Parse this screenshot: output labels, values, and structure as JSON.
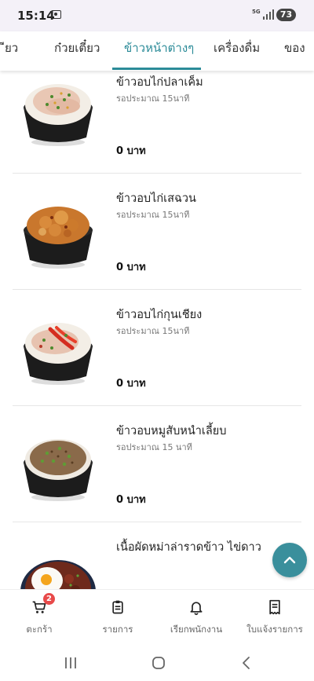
{
  "status_bar": {
    "time": "15:14",
    "network": "5G",
    "battery": "73"
  },
  "tabs": [
    {
      "label": "ข้าวยำ/เส้นก๋วยเตี๋ยว"
    },
    {
      "label": "ก๋วยเตี๋ยว"
    },
    {
      "label": "ข้าวหน้าต่างๆ",
      "active": true
    },
    {
      "label": "เครื่องดื่ม"
    },
    {
      "label": "ของหวาน"
    }
  ],
  "tab_visible": [
    "ียว",
    "ก๋วยเตี๋ยว",
    "ข้าวหน้าต่างๆ",
    "เครื่องดื่ม",
    "ของ"
  ],
  "menu_items": [
    {
      "name": "ข้าวอบไก่ปลาเค็ม",
      "wait": "รอประมาณ 15นาที",
      "price": "0 บาท"
    },
    {
      "name": "ข้าวอบไก่เสฉวน",
      "wait": "รอประมาณ 15นาที",
      "price": "0 บาท"
    },
    {
      "name": "ข้าวอบไก่กุนเชียง",
      "wait": "รอประมาณ 15นาที",
      "price": "0 บาท"
    },
    {
      "name": "ข้าวอบหมูสับหนำเลี้ยบ",
      "wait": "รอประมาณ 15 นาที",
      "price": "0 บาท"
    },
    {
      "name": "เนื้อผัดหม่าล่าราดข้าว ไข่ดาว",
      "wait": "",
      "price": ""
    }
  ],
  "bottom_nav": {
    "cart": {
      "label": "ตะกร้า",
      "badge": "2",
      "icon": "cart-icon"
    },
    "orders": {
      "label": "รายการ",
      "icon": "clipboard-icon"
    },
    "call_staff": {
      "label": "เรียกพนักงาน",
      "icon": "bell-icon"
    },
    "bill": {
      "label": "ใบแจ้งรายการ",
      "icon": "receipt-icon"
    }
  },
  "colors": {
    "accent": "#2b8b98",
    "fab": "#3a8f9c",
    "badge": "#e84a4a"
  }
}
